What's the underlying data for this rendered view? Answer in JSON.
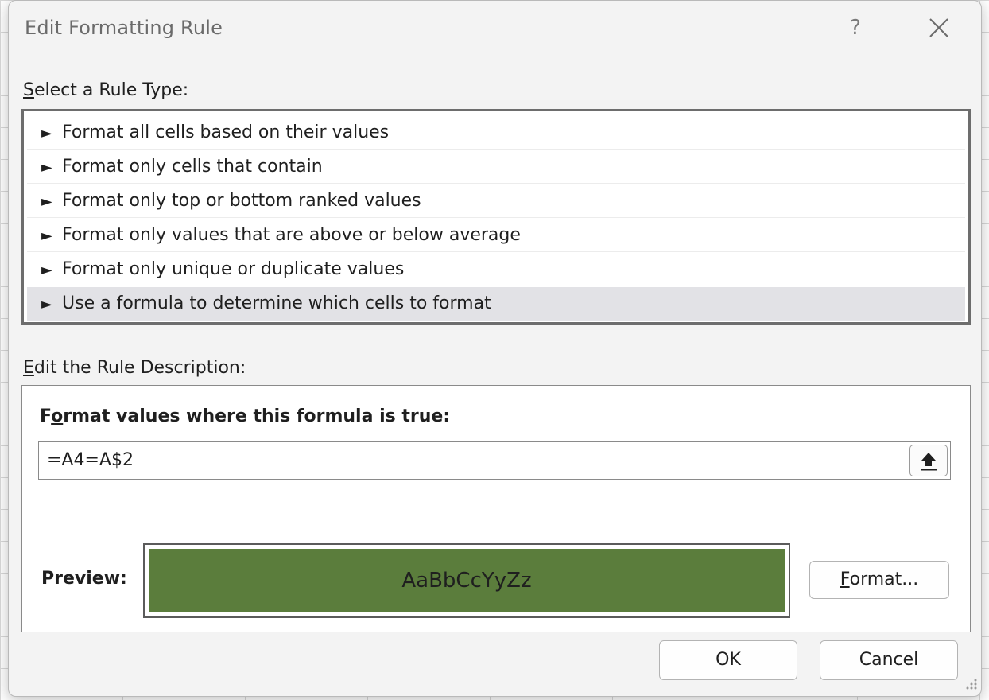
{
  "window": {
    "title": "Edit Formatting Rule",
    "help_label": "?",
    "close_icon": "close-icon"
  },
  "rule_type": {
    "label_accel": "S",
    "label_rest": "elect a Rule Type:",
    "items": [
      {
        "label": "Format all cells based on their values"
      },
      {
        "label": "Format only cells that contain"
      },
      {
        "label": "Format only top or bottom ranked values"
      },
      {
        "label": "Format only values that are above or below average"
      },
      {
        "label": "Format only unique or duplicate values"
      },
      {
        "label": "Use a formula to determine which cells to format",
        "selected": true
      }
    ],
    "bullet": "►"
  },
  "description": {
    "label_accel": "E",
    "label_rest": "dit the Rule Description:",
    "heading_pre": "F",
    "heading_accel": "o",
    "heading_rest": "rmat values where this formula is true:",
    "formula_value": "=A4=A$2",
    "collapse_icon": "collapse-dialog-icon",
    "preview_label": "Preview:",
    "preview_text": "AaBbCcYyZz",
    "preview_fill_color": "#5b7d3c",
    "format_button_accel": "F",
    "format_button_rest": "ormat..."
  },
  "buttons": {
    "ok": "OK",
    "cancel": "Cancel"
  }
}
